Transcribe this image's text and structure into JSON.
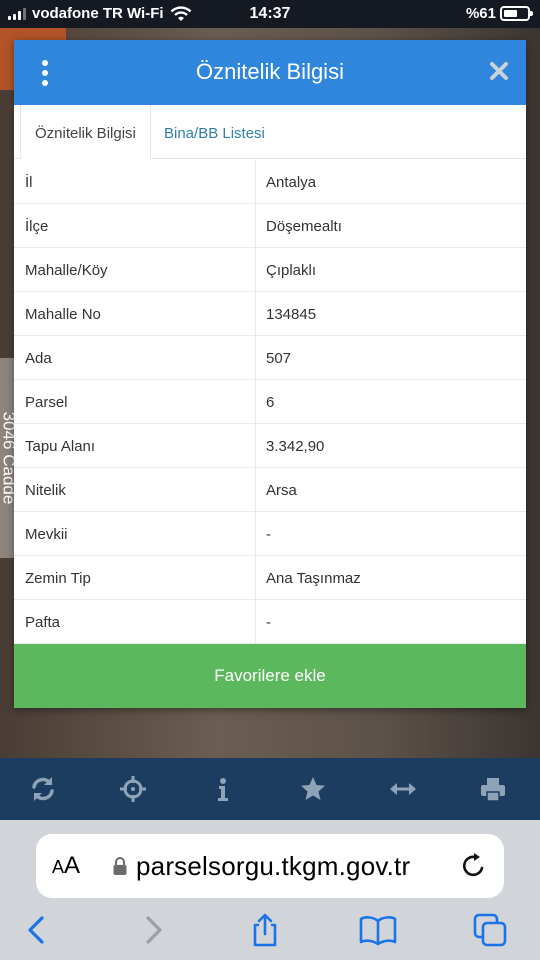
{
  "status_bar": {
    "carrier": "vodafone TR Wi-Fi",
    "time": "14:37",
    "battery": "%61",
    "battery_level": 0.61
  },
  "map": {
    "road_label": "3046 Cadde"
  },
  "modal": {
    "title": "Öznitelik Bilgisi",
    "tabs": [
      {
        "label": "Öznitelik Bilgisi"
      },
      {
        "label": "Bina/BB Listesi"
      }
    ],
    "rows": [
      {
        "key": "İl",
        "value": "Antalya"
      },
      {
        "key": "İlçe",
        "value": "Döşemealtı"
      },
      {
        "key": "Mahalle/Köy",
        "value": "Çıplaklı"
      },
      {
        "key": "Mahalle No",
        "value": "134845"
      },
      {
        "key": "Ada",
        "value": "507"
      },
      {
        "key": "Parsel",
        "value": "6"
      },
      {
        "key": "Tapu Alanı",
        "value": "3.342,90"
      },
      {
        "key": "Nitelik",
        "value": "Arsa"
      },
      {
        "key": "Mevkii",
        "value": "-"
      },
      {
        "key": "Zemin Tip",
        "value": "Ana Taşınmaz"
      },
      {
        "key": "Pafta",
        "value": "-"
      }
    ],
    "favorite_button": "Favorilere ekle"
  },
  "toolbar": {
    "icons": [
      "refresh-icon",
      "crosshair-icon",
      "info-icon",
      "star-icon",
      "measure-icon",
      "print-icon"
    ]
  },
  "browser": {
    "text_size_label_small": "A",
    "text_size_label_large": "A",
    "url": "parselsorgu.tkgm.gov.tr"
  },
  "colors": {
    "header_blue": "#2f86dc",
    "favorite_green": "#5cb85c",
    "toolbar_navy": "#1c3d5f",
    "link_blue": "#2f7eaa",
    "ios_blue": "#1a73e8"
  }
}
